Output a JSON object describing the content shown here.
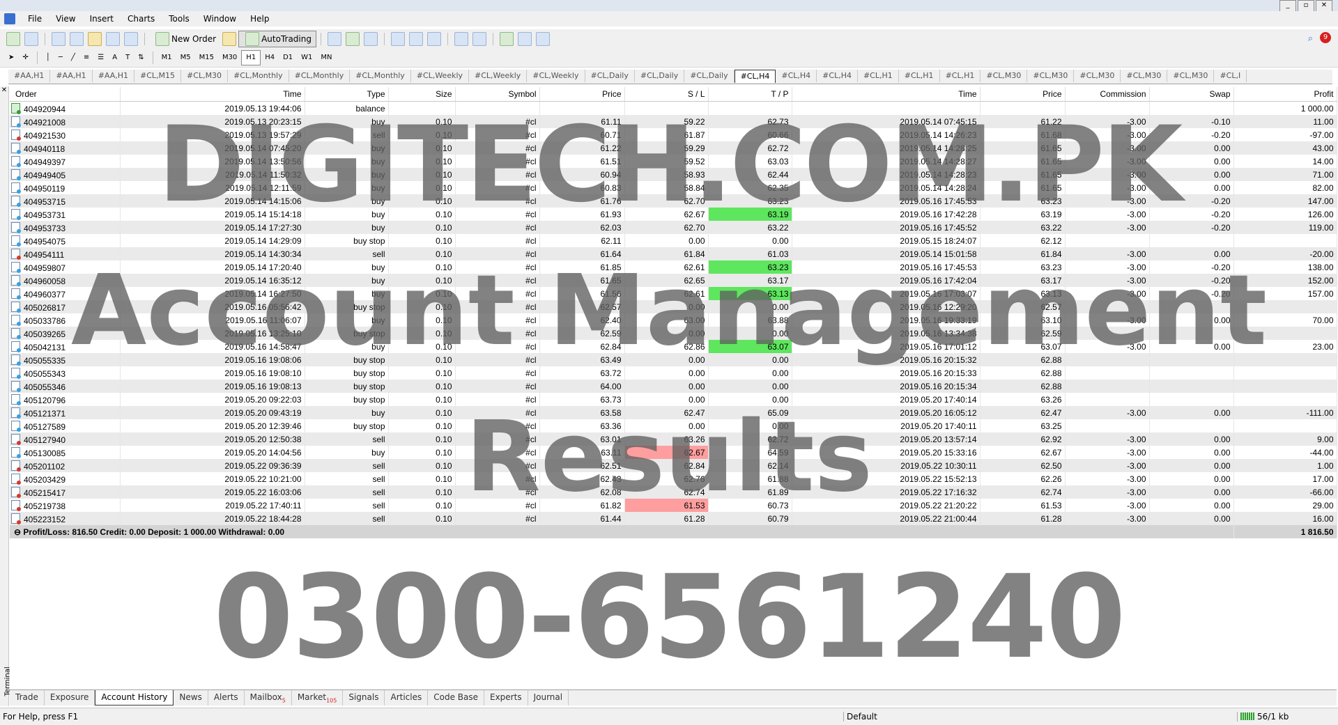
{
  "menu": [
    "File",
    "View",
    "Insert",
    "Charts",
    "Tools",
    "Window",
    "Help"
  ],
  "toolbar": {
    "new_order": "New Order",
    "auto_trading": "AutoTrading",
    "timeframes": [
      "M1",
      "M5",
      "M15",
      "M30",
      "H1",
      "H4",
      "D1",
      "W1",
      "MN"
    ],
    "active_timeframe": "H1",
    "notification_count": "9"
  },
  "chart_tabs": [
    "#AA,H1",
    "#AA,H1",
    "#AA,H1",
    "#CL,M15",
    "#CL,M30",
    "#CL,Monthly",
    "#CL,Monthly",
    "#CL,Monthly",
    "#CL,Weekly",
    "#CL,Weekly",
    "#CL,Weekly",
    "#CL,Daily",
    "#CL,Daily",
    "#CL,Daily",
    "#CL,H4",
    "#CL,H4",
    "#CL,H4",
    "#CL,H1",
    "#CL,H1",
    "#CL,H1",
    "#CL,M30",
    "#CL,M30",
    "#CL,M30",
    "#CL,M30",
    "#CL,M30",
    "#CL,I"
  ],
  "active_chart_tab": 14,
  "table": {
    "headers": [
      "Order",
      "Time",
      "Type",
      "Size",
      "Symbol",
      "Price",
      "S / L",
      "T / P",
      "Time",
      "Price",
      "Commission",
      "Swap",
      "Profit"
    ],
    "rows": [
      [
        "404920944",
        "2019.05.13 19:44:06",
        "balance",
        "",
        "",
        "",
        "",
        "",
        "",
        "",
        "",
        "",
        "1 000.00"
      ],
      [
        "404921008",
        "2019.05.13 20:23:15",
        "buy",
        "0.10",
        "#cl",
        "61.11",
        "59.22",
        "62.73",
        "2019.05.14 07:45:15",
        "61.22",
        "-3.00",
        "-0.10",
        "11.00"
      ],
      [
        "404921530",
        "2019.05.13 19:57:29",
        "sell",
        "0.10",
        "#cl",
        "60.71",
        "61.87",
        "60.66",
        "2019.05.14 14:26:23",
        "61.68",
        "-3.00",
        "-0.20",
        "-97.00"
      ],
      [
        "404940118",
        "2019.05.14 07:45:20",
        "buy",
        "0.10",
        "#cl",
        "61.22",
        "59.29",
        "62.72",
        "2019.05.14 14:28:25",
        "61.65",
        "-3.00",
        "0.00",
        "43.00"
      ],
      [
        "404949397",
        "2019.05.14 13:50:56",
        "buy",
        "0.10",
        "#cl",
        "61.51",
        "59.52",
        "63.03",
        "2019.05.14 14:28:27",
        "61.65",
        "-3.00",
        "0.00",
        "14.00"
      ],
      [
        "404949405",
        "2019.05.14 11:50:32",
        "buy",
        "0.10",
        "#cl",
        "60.94",
        "58.93",
        "62.44",
        "2019.05.14 14:28:23",
        "61.65",
        "-3.00",
        "0.00",
        "71.00"
      ],
      [
        "404950119",
        "2019.05.14 12:11:59",
        "buy",
        "0.10",
        "#cl",
        "60.83",
        "58.84",
        "62.35",
        "2019.05.14 14:28:24",
        "61.65",
        "-3.00",
        "0.00",
        "82.00"
      ],
      [
        "404953715",
        "2019.05.14 14:15:06",
        "buy",
        "0.10",
        "#cl",
        "61.76",
        "62.70",
        "63.23",
        "2019.05.16 17:45:53",
        "63.23",
        "-3.00",
        "-0.20",
        "147.00"
      ],
      [
        "404953731",
        "2019.05.14 15:14:18",
        "buy",
        "0.10",
        "#cl",
        "61.93",
        "62.67",
        "63.19",
        "2019.05.16 17:42:28",
        "63.19",
        "-3.00",
        "-0.20",
        "126.00"
      ],
      [
        "404953733",
        "2019.05.14 17:27:30",
        "buy",
        "0.10",
        "#cl",
        "62.03",
        "62.70",
        "63.22",
        "2019.05.16 17:45:52",
        "63.22",
        "-3.00",
        "-0.20",
        "119.00"
      ],
      [
        "404954075",
        "2019.05.14 14:29:09",
        "buy stop",
        "0.10",
        "#cl",
        "62.11",
        "0.00",
        "0.00",
        "2019.05.15 18:24:07",
        "62.12",
        "",
        "",
        ""
      ],
      [
        "404954111",
        "2019.05.14 14:30:34",
        "sell",
        "0.10",
        "#cl",
        "61.64",
        "61.84",
        "61.03",
        "2019.05.14 15:01:58",
        "61.84",
        "-3.00",
        "0.00",
        "-20.00"
      ],
      [
        "404959807",
        "2019.05.14 17:20:40",
        "buy",
        "0.10",
        "#cl",
        "61.85",
        "62.61",
        "63.23",
        "2019.05.16 17:45:53",
        "63.23",
        "-3.00",
        "-0.20",
        "138.00"
      ],
      [
        "404960058",
        "2019.05.14 16:35:12",
        "buy",
        "0.10",
        "#cl",
        "61.65",
        "62.65",
        "63.17",
        "2019.05.16 17:42:04",
        "63.17",
        "-3.00",
        "-0.20",
        "152.00"
      ],
      [
        "404960377",
        "2019.05.14 16:27:50",
        "buy",
        "0.10",
        "#cl",
        "61.56",
        "62.61",
        "63.13",
        "2019.05.16 17:03:07",
        "63.13",
        "-3.00",
        "-0.20",
        "157.00"
      ],
      [
        "405026817",
        "2019.05.16 05:56:42",
        "buy stop",
        "0.10",
        "#cl",
        "62.57",
        "0.00",
        "0.00",
        "2019.05.16 12:29:20",
        "62.57",
        "",
        "",
        ""
      ],
      [
        "405033786",
        "2019.05.16 11:06:07",
        "buy",
        "0.10",
        "#cl",
        "62.40",
        "63.00",
        "63.88",
        "2019.05.16 19:33:19",
        "63.10",
        "-3.00",
        "0.00",
        "70.00"
      ],
      [
        "405039265",
        "2019.05.16 13:25:10",
        "buy stop",
        "0.10",
        "#cl",
        "62.59",
        "0.00",
        "0.00",
        "2019.05.16 13:34:38",
        "62.59",
        "",
        "",
        ""
      ],
      [
        "405042131",
        "2019.05.16 14:58:47",
        "buy",
        "0.10",
        "#cl",
        "62.84",
        "62.86",
        "63.07",
        "2019.05.16 17:01:12",
        "63.07",
        "-3.00",
        "0.00",
        "23.00"
      ],
      [
        "405055335",
        "2019.05.16 19:08:06",
        "buy stop",
        "0.10",
        "#cl",
        "63.49",
        "0.00",
        "0.00",
        "2019.05.16 20:15:32",
        "62.88",
        "",
        "",
        ""
      ],
      [
        "405055343",
        "2019.05.16 19:08:10",
        "buy stop",
        "0.10",
        "#cl",
        "63.72",
        "0.00",
        "0.00",
        "2019.05.16 20:15:33",
        "62.88",
        "",
        "",
        ""
      ],
      [
        "405055346",
        "2019.05.16 19:08:13",
        "buy stop",
        "0.10",
        "#cl",
        "64.00",
        "0.00",
        "0.00",
        "2019.05.16 20:15:34",
        "62.88",
        "",
        "",
        ""
      ],
      [
        "405120796",
        "2019.05.20 09:22:03",
        "buy stop",
        "0.10",
        "#cl",
        "63.73",
        "0.00",
        "0.00",
        "2019.05.20 17:40:14",
        "63.26",
        "",
        "",
        ""
      ],
      [
        "405121371",
        "2019.05.20 09:43:19",
        "buy",
        "0.10",
        "#cl",
        "63.58",
        "62.47",
        "65.09",
        "2019.05.20 16:05:12",
        "62.47",
        "-3.00",
        "0.00",
        "-111.00"
      ],
      [
        "405127589",
        "2019.05.20 12:39:46",
        "buy stop",
        "0.10",
        "#cl",
        "63.36",
        "0.00",
        "0.00",
        "2019.05.20 17:40:11",
        "63.25",
        "",
        "",
        ""
      ],
      [
        "405127940",
        "2019.05.20 12:50:38",
        "sell",
        "0.10",
        "#cl",
        "63.01",
        "63.26",
        "62.72",
        "2019.05.20 13:57:14",
        "62.92",
        "-3.00",
        "0.00",
        "9.00"
      ],
      [
        "405130085",
        "2019.05.20 14:04:56",
        "buy",
        "0.10",
        "#cl",
        "63.11",
        "62.67",
        "64.59",
        "2019.05.20 15:33:16",
        "62.67",
        "-3.00",
        "0.00",
        "-44.00"
      ],
      [
        "405201102",
        "2019.05.22 09:36:39",
        "sell",
        "0.10",
        "#cl",
        "62.51",
        "62.84",
        "62.14",
        "2019.05.22 10:30:11",
        "62.50",
        "-3.00",
        "0.00",
        "1.00"
      ],
      [
        "405203429",
        "2019.05.22 10:21:00",
        "sell",
        "0.10",
        "#cl",
        "62.43",
        "62.76",
        "61.88",
        "2019.05.22 15:52:13",
        "62.26",
        "-3.00",
        "0.00",
        "17.00"
      ],
      [
        "405215417",
        "2019.05.22 16:03:06",
        "sell",
        "0.10",
        "#cl",
        "62.08",
        "62.74",
        "61.89",
        "2019.05.22 17:16:32",
        "62.74",
        "-3.00",
        "0.00",
        "-66.00"
      ],
      [
        "405219738",
        "2019.05.22 17:40:11",
        "sell",
        "0.10",
        "#cl",
        "61.82",
        "61.53",
        "60.73",
        "2019.05.22 21:20:22",
        "61.53",
        "-3.00",
        "0.00",
        "29.00"
      ],
      [
        "405223152",
        "2019.05.22 18:44:28",
        "sell",
        "0.10",
        "#cl",
        "61.44",
        "61.28",
        "60.79",
        "2019.05.22 21:00:44",
        "61.28",
        "-3.00",
        "0.00",
        "16.00"
      ]
    ],
    "sl_hit_rows": [
      11,
      23,
      26,
      29,
      30,
      31
    ],
    "tp_hit_rows": [
      7,
      8,
      9,
      12,
      13,
      14,
      18
    ],
    "summary": {
      "text": "Profit/Loss: 816.50  Credit: 0.00  Deposit: 1 000.00  Withdrawal: 0.00",
      "total": "1 816.50"
    }
  },
  "watermark": {
    "line1": "DIGITECH.COM.PK",
    "line2": "Account Management",
    "line3": "Results",
    "line4": "0300-6561240"
  },
  "terminal_label": "Terminal",
  "bottom_tabs": [
    {
      "label": "Trade",
      "badge": ""
    },
    {
      "label": "Exposure",
      "badge": ""
    },
    {
      "label": "Account History",
      "badge": ""
    },
    {
      "label": "News",
      "badge": ""
    },
    {
      "label": "Alerts",
      "badge": ""
    },
    {
      "label": "Mailbox",
      "badge": "5"
    },
    {
      "label": "Market",
      "badge": "105"
    },
    {
      "label": "Signals",
      "badge": ""
    },
    {
      "label": "Articles",
      "badge": ""
    },
    {
      "label": "Code Base",
      "badge": ""
    },
    {
      "label": "Experts",
      "badge": ""
    },
    {
      "label": "Journal",
      "badge": ""
    }
  ],
  "active_bottom_tab": 2,
  "status": {
    "help": "For Help, press F1",
    "profile": "Default",
    "traffic": "56/1 kb"
  }
}
